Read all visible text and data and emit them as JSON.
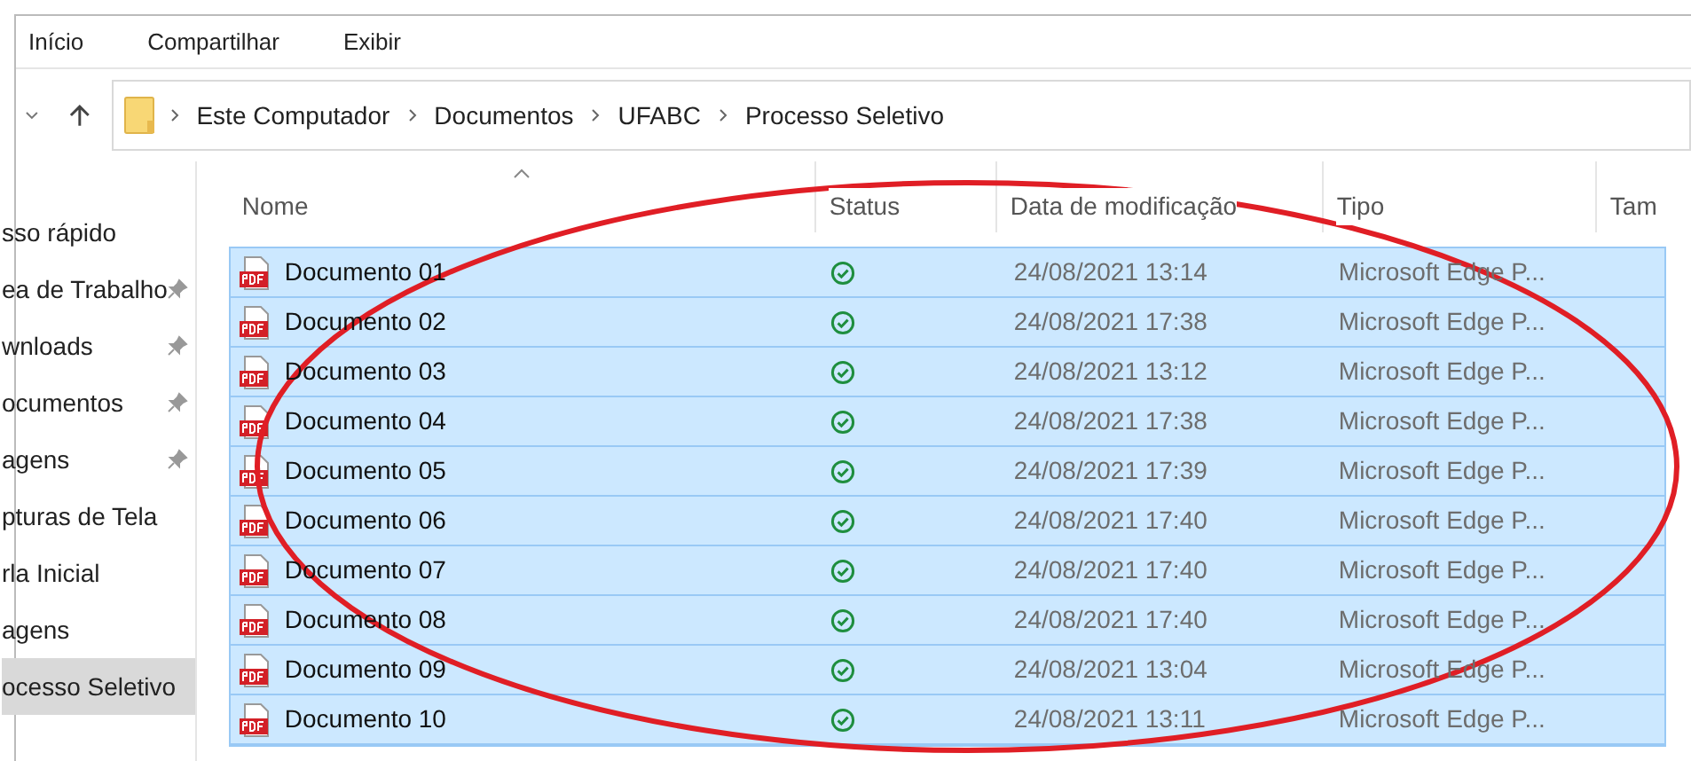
{
  "ribbon_tabs": [
    {
      "label": "Início",
      "selected": false
    },
    {
      "label": "Compartilhar",
      "selected": false
    },
    {
      "label": "Exibir",
      "selected": false
    }
  ],
  "breadcrumb": [
    "Este Computador",
    "Documentos",
    "UFABC",
    "Processo Seletivo"
  ],
  "sidebar": {
    "items": [
      {
        "label": "sso rápido",
        "pinned": false,
        "selected": false
      },
      {
        "label": "ea de Trabalho",
        "pinned": true,
        "selected": false
      },
      {
        "label": "wnloads",
        "pinned": true,
        "selected": false
      },
      {
        "label": "ocumentos",
        "pinned": true,
        "selected": false
      },
      {
        "label": "agens",
        "pinned": true,
        "selected": false
      },
      {
        "label": "pturas de Tela",
        "pinned": false,
        "selected": false
      },
      {
        "label": "rla Inicial",
        "pinned": false,
        "selected": false
      },
      {
        "label": "agens",
        "pinned": false,
        "selected": false
      },
      {
        "label": "ocesso Seletivo",
        "pinned": false,
        "selected": true
      }
    ]
  },
  "table": {
    "columns": [
      "Nome",
      "Status",
      "Data de modificação",
      "Tipo",
      "Tam"
    ],
    "rows": [
      {
        "name": "Documento 01",
        "synced": true,
        "date": "24/08/2021 13:14",
        "type": "Microsoft Edge P...",
        "selected": true
      },
      {
        "name": "Documento 02",
        "synced": true,
        "date": "24/08/2021 17:38",
        "type": "Microsoft Edge P...",
        "selected": true
      },
      {
        "name": "Documento 03",
        "synced": true,
        "date": "24/08/2021 13:12",
        "type": "Microsoft Edge P...",
        "selected": true
      },
      {
        "name": "Documento 04",
        "synced": true,
        "date": "24/08/2021 17:38",
        "type": "Microsoft Edge P...",
        "selected": true
      },
      {
        "name": "Documento 05",
        "synced": true,
        "date": "24/08/2021 17:39",
        "type": "Microsoft Edge P...",
        "selected": true
      },
      {
        "name": "Documento 06",
        "synced": true,
        "date": "24/08/2021 17:40",
        "type": "Microsoft Edge P...",
        "selected": true
      },
      {
        "name": "Documento 07",
        "synced": true,
        "date": "24/08/2021 17:40",
        "type": "Microsoft Edge P...",
        "selected": true
      },
      {
        "name": "Documento 08",
        "synced": true,
        "date": "24/08/2021 17:40",
        "type": "Microsoft Edge P...",
        "selected": true
      },
      {
        "name": "Documento 09",
        "synced": true,
        "date": "24/08/2021 13:04",
        "type": "Microsoft Edge P...",
        "selected": true
      },
      {
        "name": "Documento 10",
        "synced": true,
        "date": "24/08/2021 13:11",
        "type": "Microsoft Edge P...",
        "selected": true
      }
    ]
  }
}
